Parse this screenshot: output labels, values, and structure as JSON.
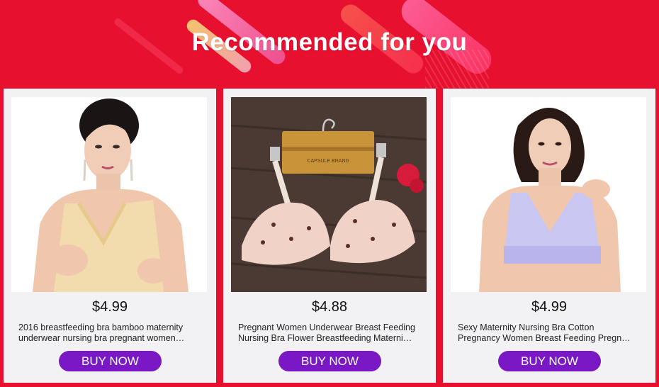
{
  "banner": {
    "title": "Recommended for you"
  },
  "products": [
    {
      "price": "$4.99",
      "desc_line1": "2016 breastfeeding bra bamboo maternity",
      "desc_line2": "underwear nursing bra pregnant women…",
      "button": "BUY NOW",
      "image_desc": "woman-beige-nursing-bra"
    },
    {
      "price": "$4.88",
      "desc_line1": "Pregnant Women Underwear Breast Feeding",
      "desc_line2": "Nursing Bra Flower Breastfeeding Materni…",
      "button": "BUY NOW",
      "image_desc": "floral-bra-on-hanger",
      "hanger_text": "CAPSULE BRAND"
    },
    {
      "price": "$4.99",
      "desc_line1": "Sexy Maternity Nursing Bra Cotton",
      "desc_line2": "Pregnancy Women Breast Feeding Pregn…",
      "button": "BUY NOW",
      "image_desc": "woman-lavender-nursing-bra"
    }
  ],
  "colors": {
    "background": "#e8102f",
    "button": "#7a18c6",
    "card": "#f2f2f4"
  }
}
